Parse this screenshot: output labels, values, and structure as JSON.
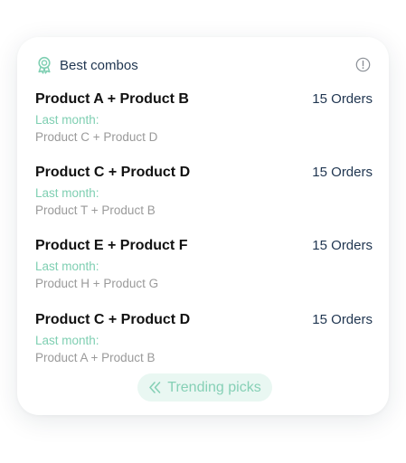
{
  "card": {
    "title": "Best combos",
    "title_icon": "award-ribbon-icon",
    "info_icon": "info-icon",
    "accent_color": "#7fcfb2"
  },
  "combos": [
    {
      "name": "Product A + Product B",
      "orders": "15 Orders",
      "last_month_label": "Last month:",
      "last_month_combo": "Product C + Product D"
    },
    {
      "name": "Product C + Product D",
      "orders": "15 Orders",
      "last_month_label": "Last month:",
      "last_month_combo": "Product T + Product B"
    },
    {
      "name": "Product E + Product F",
      "orders": "15 Orders",
      "last_month_label": "Last month:",
      "last_month_combo": "Product H + Product G"
    },
    {
      "name": "Product C + Product D",
      "orders": "15 Orders",
      "last_month_label": "Last month:",
      "last_month_combo": "Product A + Product B"
    }
  ],
  "trending_button": {
    "label": "Trending picks",
    "icon": "double-chevron-left-icon"
  }
}
